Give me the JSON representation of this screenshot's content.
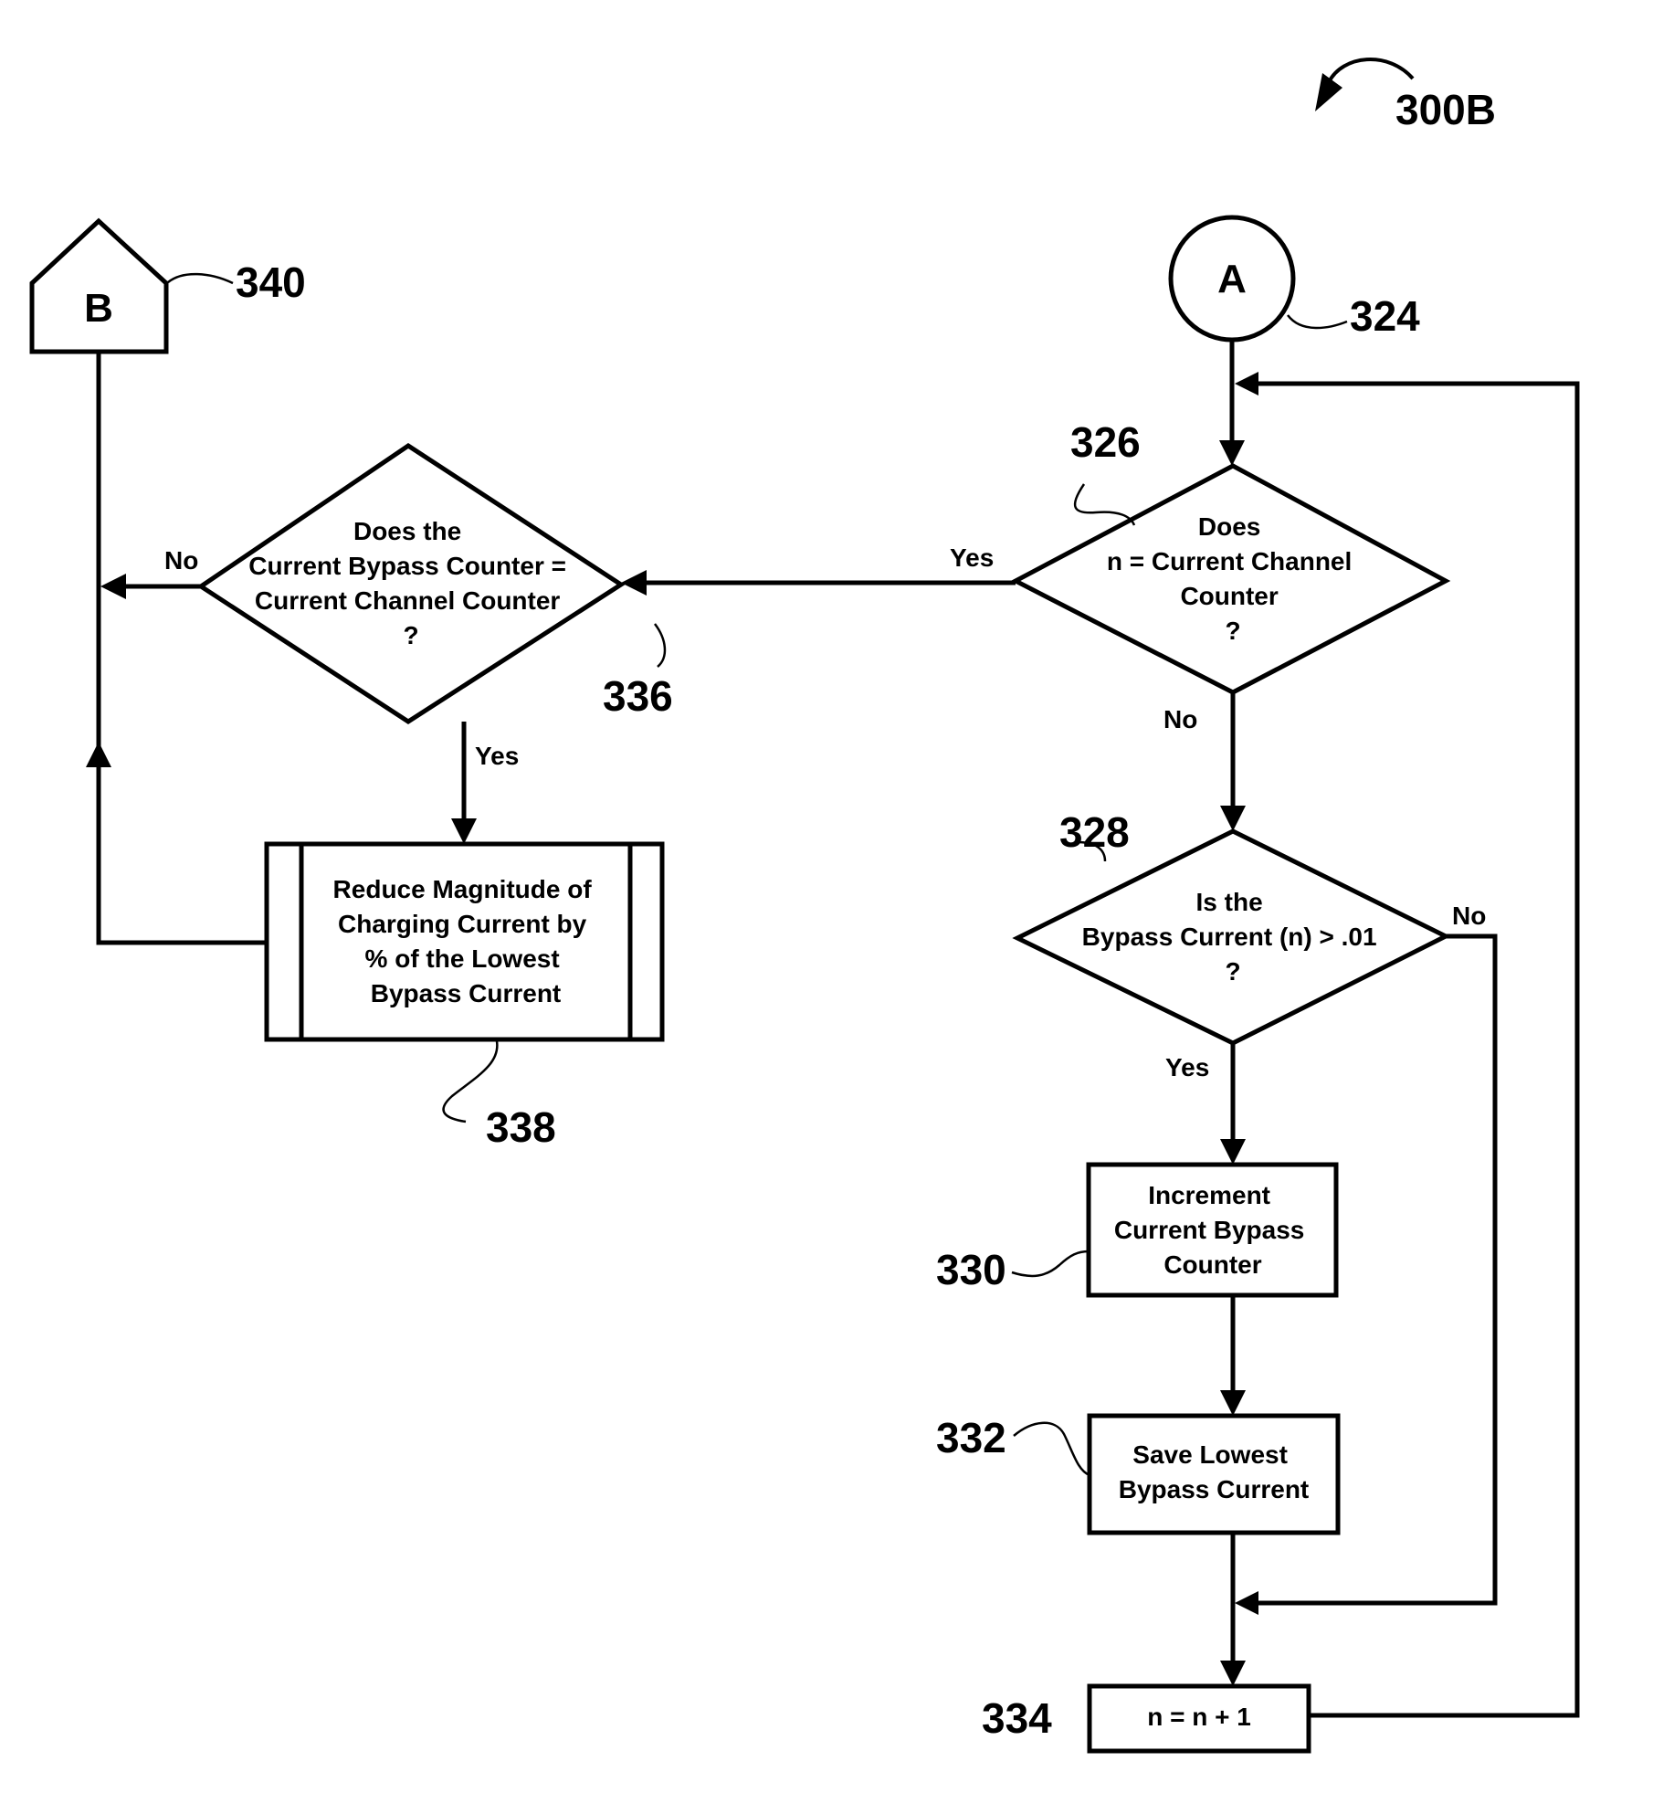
{
  "figure": {
    "id_label": "300B"
  },
  "connectors": {
    "a": {
      "letter": "A",
      "ref": "324"
    },
    "b": {
      "letter": "B",
      "ref": "340"
    }
  },
  "nodes": {
    "d326": {
      "ref": "326",
      "lines": [
        "Does",
        "n = Current Channel",
        "Counter",
        "?"
      ]
    },
    "d328": {
      "ref": "328",
      "lines": [
        "Is the",
        "Bypass Current (n) > .01",
        "?"
      ]
    },
    "b330": {
      "ref": "330",
      "lines": [
        "Increment",
        "Current Bypass",
        "Counter"
      ]
    },
    "b332": {
      "ref": "332",
      "lines": [
        "Save Lowest",
        "Bypass Current"
      ]
    },
    "b334": {
      "ref": "334",
      "lines": [
        "n = n + 1"
      ]
    },
    "d336": {
      "ref": "336",
      "lines": [
        "Does the",
        "Current Bypass Counter =",
        "Current Channel Counter",
        "?"
      ]
    },
    "b338": {
      "ref": "338",
      "lines": [
        "Reduce Magnitude of",
        "Charging Current by",
        "% of the Lowest",
        "Bypass Current"
      ]
    }
  },
  "edges": {
    "d326_yes": "Yes",
    "d326_no": "No",
    "d328_yes": "Yes",
    "d328_no": "No",
    "d336_yes": "Yes",
    "d336_no": "No"
  }
}
